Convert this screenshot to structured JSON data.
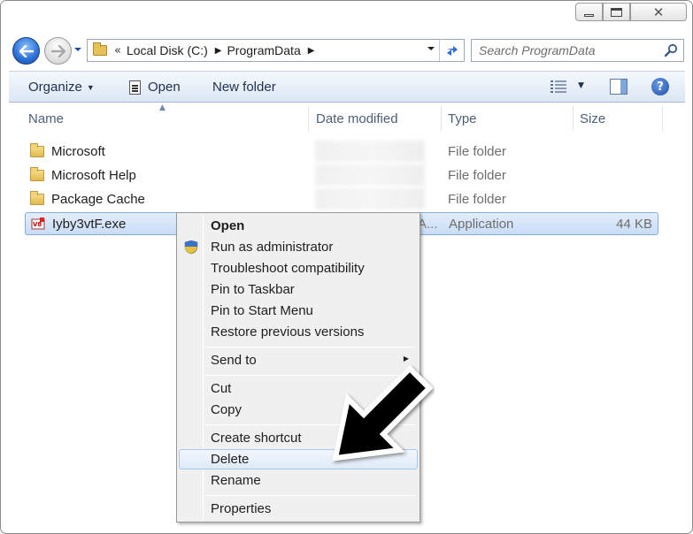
{
  "window": {
    "close_glyph": "✕"
  },
  "address_bar": {
    "overflow": "«",
    "crumbs": [
      "Local Disk (C:)",
      "ProgramData"
    ]
  },
  "search": {
    "placeholder": "Search ProgramData"
  },
  "toolbar": {
    "organize": "Organize",
    "open": "Open",
    "new_folder": "New folder",
    "help": "?"
  },
  "columns": {
    "name": "Name",
    "date_modified": "Date modified",
    "type": "Type",
    "size": "Size"
  },
  "files": [
    {
      "name": "Microsoft",
      "type": "File folder",
      "size": ""
    },
    {
      "name": "Microsoft Help",
      "type": "File folder",
      "size": ""
    },
    {
      "name": "Package Cache",
      "type": "File folder",
      "size": ""
    },
    {
      "name": "Iyby3vtF.exe",
      "date_trunc": "A...",
      "type": "Application",
      "size": "44 KB"
    }
  ],
  "context_menu": {
    "open": "Open",
    "run_as_admin": "Run as administrator",
    "troubleshoot": "Troubleshoot compatibility",
    "pin_taskbar": "Pin to Taskbar",
    "pin_start": "Pin to Start Menu",
    "restore_prev": "Restore previous versions",
    "send_to": "Send to",
    "cut": "Cut",
    "copy": "Copy",
    "create_shortcut": "Create shortcut",
    "delete": "Delete",
    "rename": "Rename",
    "properties": "Properties"
  },
  "colors": {
    "selection": "#cfe1f7",
    "toolbar": "#dbe6f4",
    "menu_bg": "#f0f0f0"
  }
}
